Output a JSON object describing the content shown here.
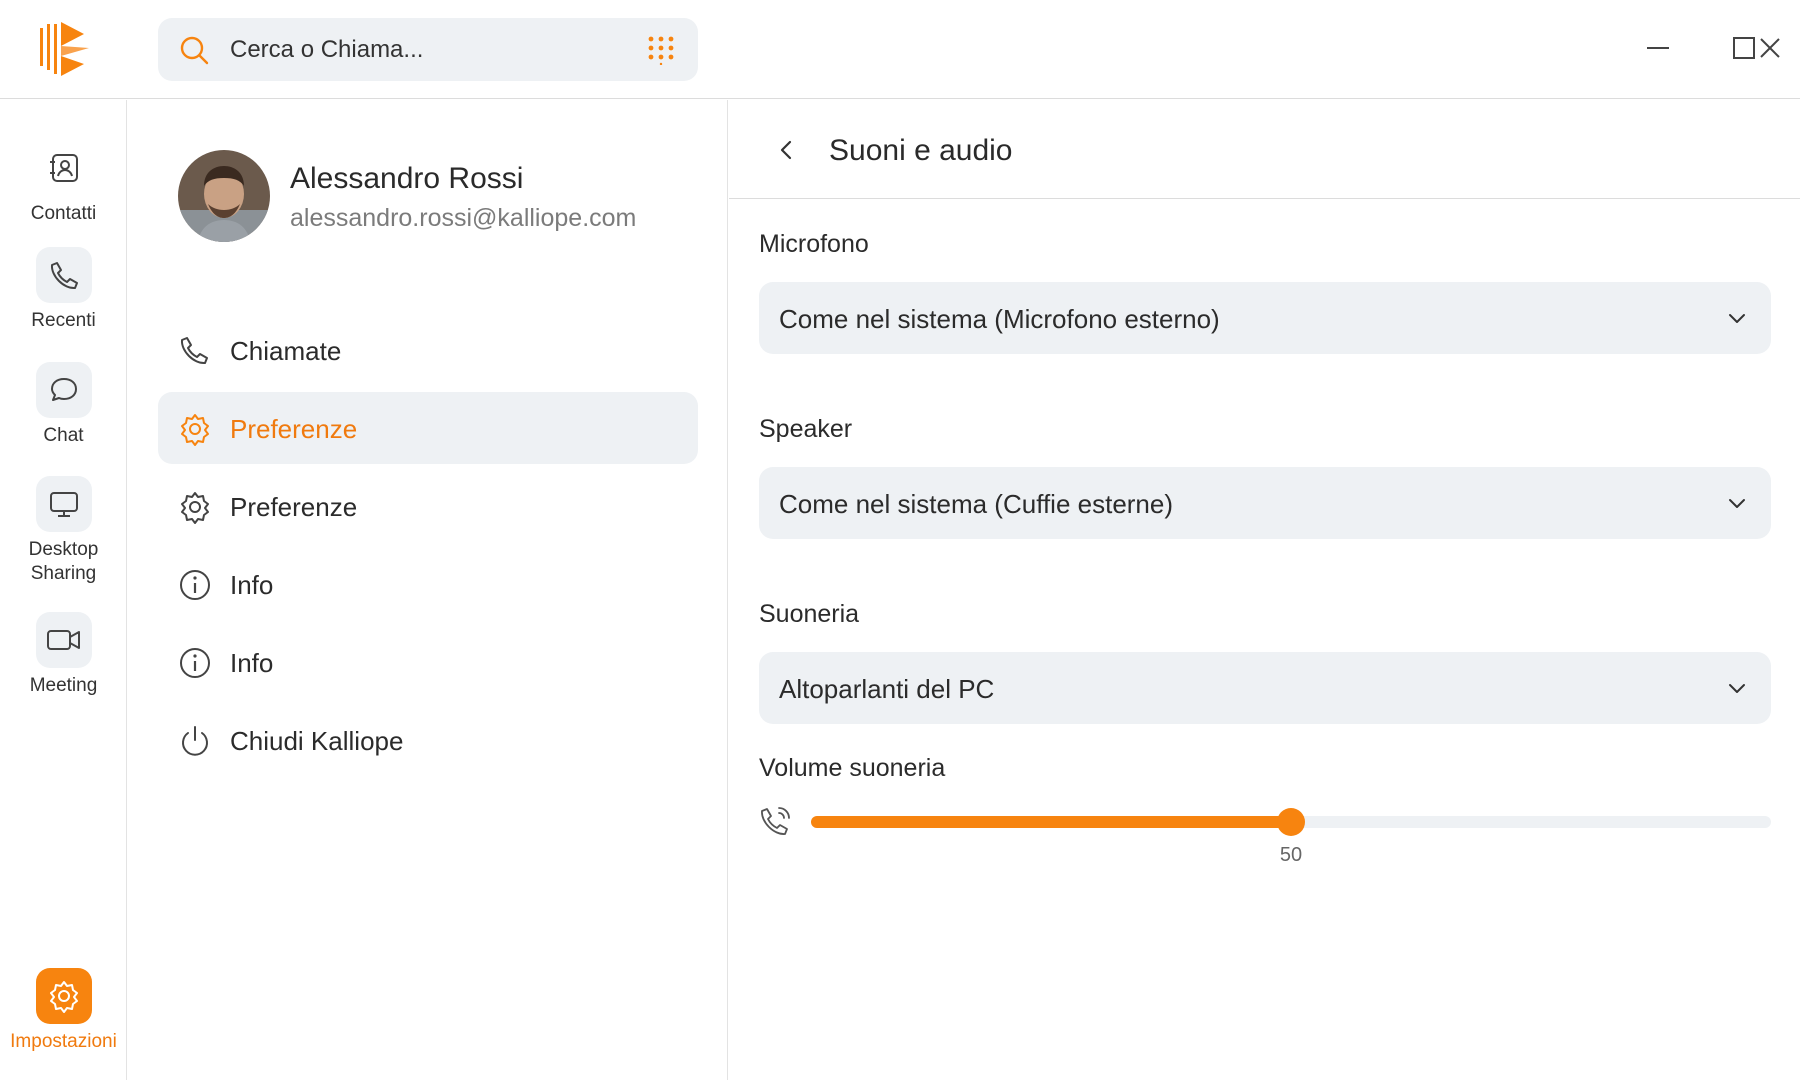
{
  "colors": {
    "accent": "#f7840f",
    "panel_bg": "#eef1f4",
    "text": "#2b2b2b",
    "muted": "#7b7b7b"
  },
  "search": {
    "placeholder": "Cerca o Chiama...",
    "icon": "search-icon",
    "dialpad_icon": "dialpad-icon"
  },
  "window_controls": [
    "minimize-icon",
    "maximize-icon",
    "close-icon"
  ],
  "rail": {
    "items": [
      {
        "label": "Contatti",
        "icon": "contacts-icon"
      },
      {
        "label": "Recenti",
        "icon": "phone-icon"
      },
      {
        "label": "Chat",
        "icon": "chat-icon"
      },
      {
        "label": "Desktop Sharing",
        "icon": "monitor-icon"
      },
      {
        "label": "Meeting",
        "icon": "video-icon"
      }
    ],
    "settings": {
      "label": "Impostazioni",
      "icon": "gear-icon",
      "active": true
    }
  },
  "profile": {
    "name": "Alessandro Rossi",
    "email": "alessandro.rossi@kalliope.com"
  },
  "menu": {
    "items": [
      {
        "label": "Chiamate",
        "icon": "phone-icon",
        "active": false
      },
      {
        "label": "Preferenze",
        "icon": "gear-icon",
        "active": true
      },
      {
        "label": "Preferenze",
        "icon": "gear-icon",
        "active": false
      },
      {
        "label": "Info",
        "icon": "info-icon",
        "active": false
      },
      {
        "label": "Info",
        "icon": "info-icon",
        "active": false
      },
      {
        "label": "Chiudi Kalliope",
        "icon": "power-icon",
        "active": false
      }
    ]
  },
  "panel": {
    "title": "Suoni e audio",
    "microphone": {
      "label": "Microfono",
      "value": "Come nel sistema (Microfono esterno)"
    },
    "speaker": {
      "label": "Speaker",
      "value": "Come nel sistema (Cuffie esterne)"
    },
    "ringtone": {
      "label": "Suoneria",
      "value": "Altoparlanti del PC"
    },
    "volume": {
      "label": "Volume suoneria",
      "value": "50",
      "fraction": 0.5
    }
  }
}
